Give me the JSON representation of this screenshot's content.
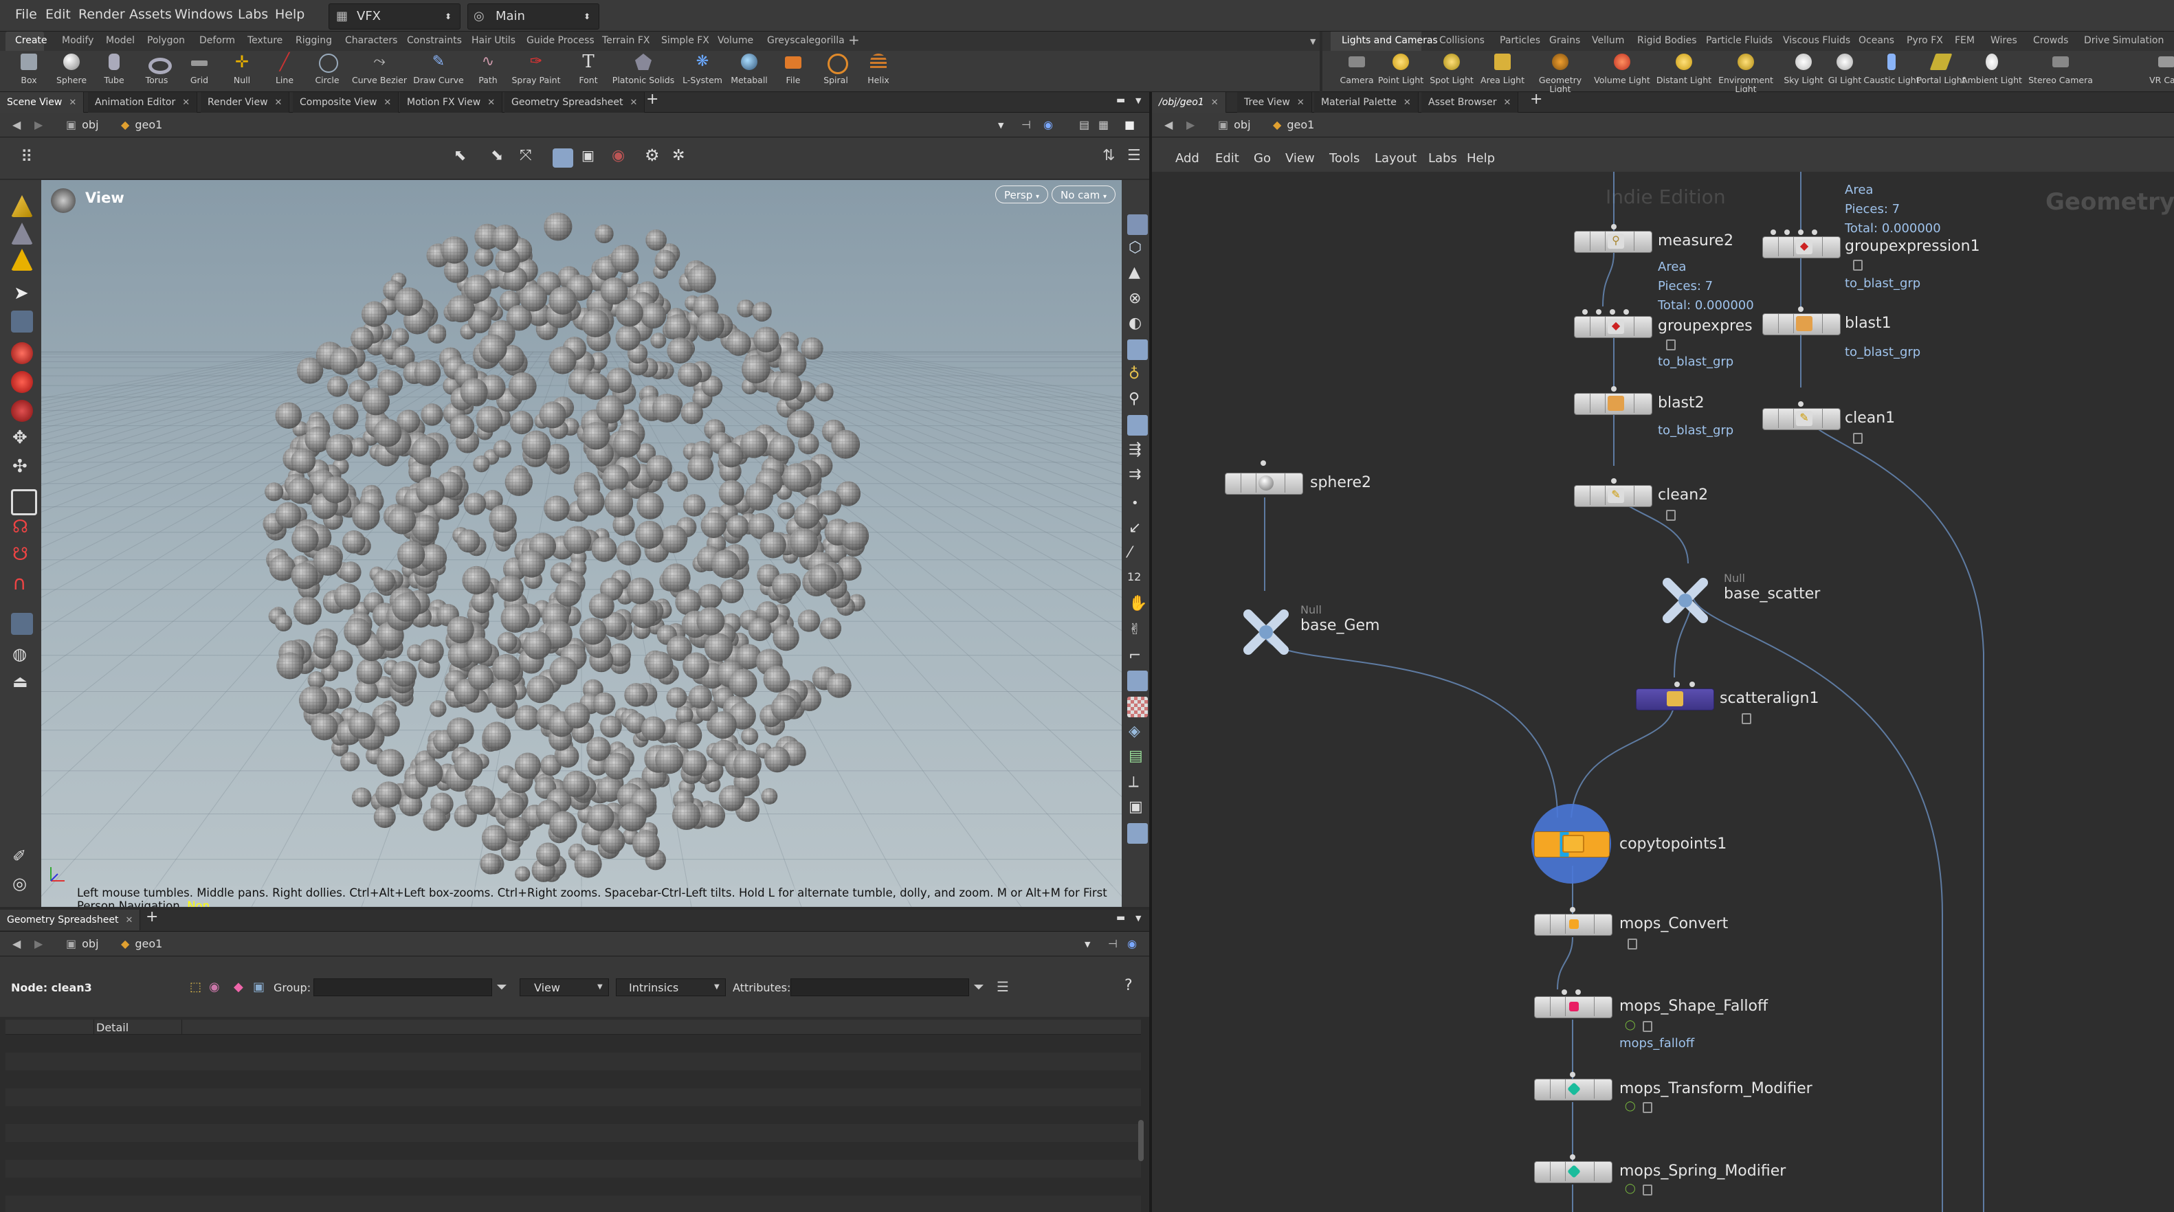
{
  "menu": {
    "items": [
      "File",
      "Edit",
      "Render",
      "Assets",
      "Windows",
      "Labs",
      "Help"
    ],
    "desktop": "VFX",
    "context": "Main"
  },
  "shelf_left": {
    "tabs": [
      "Create",
      "Modify",
      "Model",
      "Polygon",
      "Deform",
      "Texture",
      "Rigging",
      "Characters",
      "Constraints",
      "Hair Utils",
      "Guide Process",
      "Terrain FX",
      "Simple FX",
      "Volume",
      "Greyscalegorilla"
    ],
    "tools": [
      "Box",
      "Sphere",
      "Tube",
      "Torus",
      "Grid",
      "Null",
      "Line",
      "Circle",
      "Curve Bezier",
      "Draw Curve",
      "Path",
      "Spray Paint",
      "Font",
      "Platonic Solids",
      "L-System",
      "Metaball",
      "File",
      "Spiral",
      "Helix"
    ]
  },
  "shelf_right": {
    "tabs": [
      "Lights and Cameras",
      "Collisions",
      "Particles",
      "Grains",
      "Vellum",
      "Rigid Bodies",
      "Particle Fluids",
      "Viscous Fluids",
      "Oceans",
      "Pyro FX",
      "FEM",
      "Wires",
      "Crowds",
      "Drive Simulation"
    ],
    "tools": [
      "Camera",
      "Point Light",
      "Spot Light",
      "Area Light",
      "Geometry Light",
      "Volume Light",
      "Distant Light",
      "Environment Light",
      "Sky Light",
      "GI Light",
      "Caustic Light",
      "Portal Light",
      "Ambient Light",
      "Stereo Camera",
      "VR Cam"
    ]
  },
  "left_pane": {
    "tabs": [
      "Scene View",
      "Animation Editor",
      "Render View",
      "Composite View",
      "Motion FX View",
      "Geometry Spreadsheet"
    ],
    "path": {
      "root": "obj",
      "node": "geo1"
    },
    "viewport": {
      "title": "View",
      "persp": "Persp",
      "cam": "No cam",
      "status": "Left mouse tumbles. Middle pans. Right dollies. Ctrl+Alt+Left box-zooms. Ctrl+Right zooms. Spacebar-Ctrl-Left tilts. Hold L for alternate tumble, dolly, and zoom. M or Alt+M for First Person Navigation.",
      "status_tail": "Non"
    }
  },
  "spreadsheet": {
    "tabs": [
      "Geometry Spreadsheet"
    ],
    "path": {
      "root": "obj",
      "node": "geo1"
    },
    "node_label": "Node: clean3",
    "group_label": "Group:",
    "view_label": "View",
    "intrinsics_label": "Intrinsics",
    "attributes_label": "Attributes:",
    "column": "Detail"
  },
  "right_pane": {
    "tabs": [
      "/obj/geo1",
      "Tree View",
      "Material Palette",
      "Asset Browser"
    ],
    "path": {
      "root": "obj",
      "node": "geo1"
    },
    "menu": [
      "Add",
      "Edit",
      "Go",
      "View",
      "Tools",
      "Layout",
      "Labs",
      "Help"
    ],
    "watermark": "Indie Edition",
    "context_label": "Geometry"
  },
  "nodes": {
    "measure2": {
      "name": "measure2",
      "info": [
        "Area",
        "Pieces: 7",
        "Total: 0.000000"
      ]
    },
    "groupexpression1": {
      "name": "groupexpression1",
      "info": [
        "Area",
        "Pieces: 7",
        "Total: 0.000000"
      ],
      "group": "to_blast_grp"
    },
    "groupexpression2": {
      "name": "groupexpres",
      "group": "to_blast_grp"
    },
    "blast1": {
      "name": "blast1",
      "group": "to_blast_grp"
    },
    "blast2": {
      "name": "blast2",
      "group": "to_blast_grp"
    },
    "clean1": {
      "name": "clean1"
    },
    "clean2": {
      "name": "clean2"
    },
    "sphere2": {
      "name": "sphere2"
    },
    "base_gem": {
      "type": "Null",
      "name": "base_Gem"
    },
    "base_scatter": {
      "type": "Null",
      "name": "base_scatter"
    },
    "scatteralign1": {
      "name": "scatteralign1"
    },
    "copytopoints1": {
      "name": "copytopoints1"
    },
    "mops_convert": {
      "name": "mops_Convert"
    },
    "mops_shape_falloff": {
      "name": "mops_Shape_Falloff",
      "sub": "mops_falloff"
    },
    "mops_transform": {
      "name": "mops_Transform_Modifier"
    },
    "mops_spring": {
      "name": "mops_Spring_Modifier"
    }
  },
  "colors": {
    "bg": "#2b2b2b",
    "accent": "#f5a623",
    "link": "#9fc3ec",
    "viewport_top": "#889ba8",
    "viewport_bottom": "#bac5ca",
    "copy_ring": "#4a78d8"
  }
}
